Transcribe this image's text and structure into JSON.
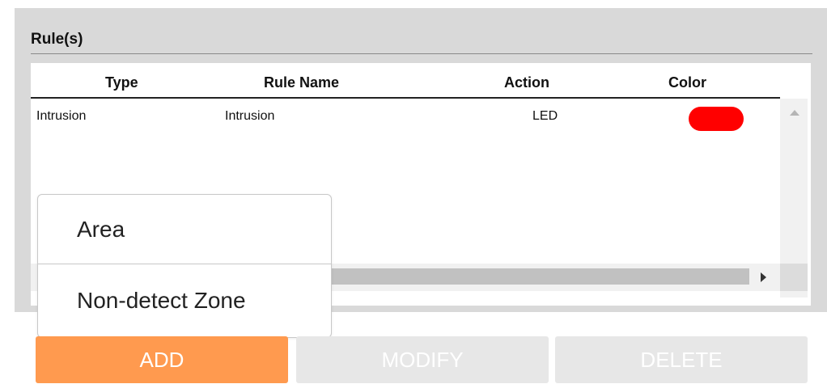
{
  "rules_panel": {
    "title": "Rule(s)",
    "columns": [
      "Type",
      "Rule Name",
      "Action",
      "Color"
    ],
    "rows": [
      {
        "type": "Intrusion",
        "rule_name": "Intrusion",
        "action": "LED",
        "color": "#ff0000"
      }
    ]
  },
  "dropdown": {
    "items": [
      "Area",
      "Non-detect Zone"
    ]
  },
  "buttons": {
    "add": "ADD",
    "modify": "MODIFY",
    "delete": "DELETE"
  },
  "colors": {
    "accent": "#ff9a4f",
    "disabled_button": "#e7e7e7",
    "panel": "#d9d9d9"
  }
}
